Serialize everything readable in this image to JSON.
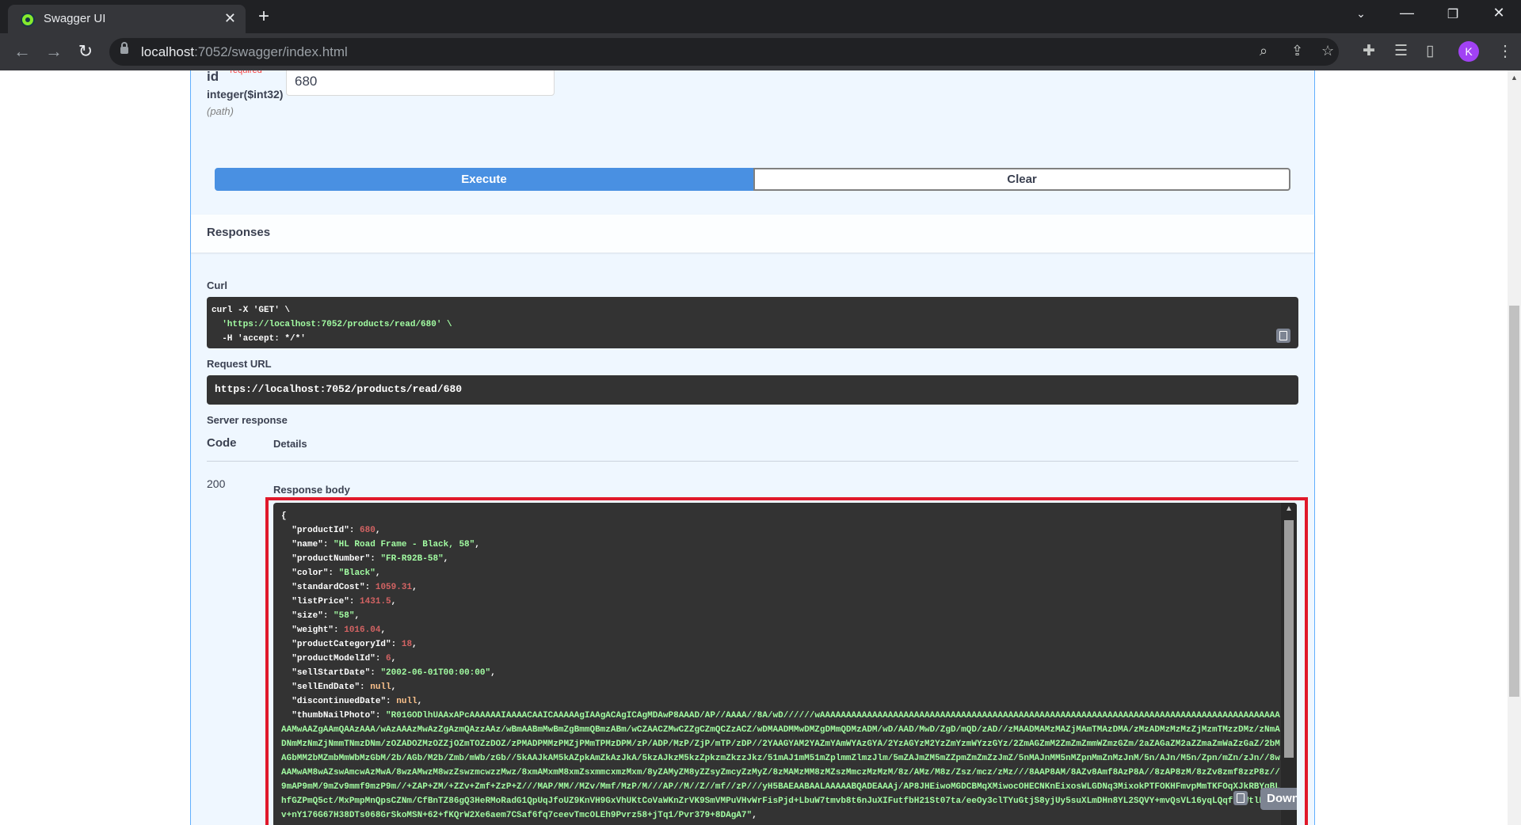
{
  "browser": {
    "tab_title": "Swagger UI",
    "url_host": "localhost",
    "url_path": ":7052/swagger/index.html",
    "profile_initial": "K"
  },
  "parameter": {
    "name": "id",
    "required_marker": "*",
    "required_label": "required",
    "type": "integer($int32)",
    "location": "(path)",
    "value": "680"
  },
  "actions": {
    "execute_label": "Execute",
    "clear_label": "Clear"
  },
  "responses": {
    "title": "Responses",
    "curl_label": "Curl",
    "curl_lines": [
      "curl -X 'GET' \\",
      "  'https://localhost:7052/products/read/680' \\",
      "  -H 'accept: */*'"
    ],
    "request_url_label": "Request URL",
    "request_url": "https://localhost:7052/products/read/680",
    "server_response_label": "Server response",
    "col_code": "Code",
    "col_details": "Details",
    "status_code": "200",
    "response_body_label": "Response body",
    "download_label": "Download"
  },
  "response_body": {
    "open_brace": "{",
    "fields": [
      {
        "key": "productId",
        "value": "680",
        "kind": "number"
      },
      {
        "key": "name",
        "value": "\"HL Road Frame - Black, 58\"",
        "kind": "string"
      },
      {
        "key": "productNumber",
        "value": "\"FR-R92B-58\"",
        "kind": "string"
      },
      {
        "key": "color",
        "value": "\"Black\"",
        "kind": "string"
      },
      {
        "key": "standardCost",
        "value": "1059.31",
        "kind": "number"
      },
      {
        "key": "listPrice",
        "value": "1431.5",
        "kind": "number"
      },
      {
        "key": "size",
        "value": "\"58\"",
        "kind": "string"
      },
      {
        "key": "weight",
        "value": "1016.04",
        "kind": "number"
      },
      {
        "key": "productCategoryId",
        "value": "18",
        "kind": "number"
      },
      {
        "key": "productModelId",
        "value": "6",
        "kind": "number"
      },
      {
        "key": "sellStartDate",
        "value": "\"2002-06-01T00:00:00\"",
        "kind": "string"
      },
      {
        "key": "sellEndDate",
        "value": "null",
        "kind": "null"
      },
      {
        "key": "discontinuedDate",
        "value": "null",
        "kind": "null"
      }
    ],
    "thumbnail_key": "thumbNailPhoto",
    "thumbnail_value": "\"R01GODlhUAAxAPcAAAAAAIAAAACAAICAAAAAgIAAgACAgICAgMDAwP8AAAD/AP//AAAA//8A/wD//////wAAAAAAAAAAAAAAAAAAAAAAAAAAAAAAAAAAAAAAAAAAAAAAAAAAAAAAAAAAAAAAAAAAAAAAAAAAAAAAAAAAAAAAAAAAMwAAZgAAmQAAzAAA/wAzAAAzMwAzZgAzmQAzzAAz/wBmAABmMwBmZgBmmQBmzABm/wCZAACZMwCZZgCZmQCZzACZ/wDMAADMMwDMZgDMmQDMzADM/wD/AAD/MwD/ZgD/mQD/zAD//zMAADMAMzMAZjMAmTMAzDMA/zMzADMzMzMzZjMzmTMzzDMz/zNmADNmMzNmZjNmmTNmzDNm/zOZADOZMzOZZjOZmTOZzDOZ/zPMADPMMzPMZjPMmTPMzDPM/zP/ADP/MzP/ZjP/mTP/zDP//2YAAGYAM2YAZmYAmWYAzGYA/2YzAGYzM2YzZmYzmWYzzGYz/2ZmAGZmM2ZmZmZmmWZmzGZm/2aZAGaZM2aZZmaZmWaZzGaZ/2bMAGbMM2bMZmbMmWbMzGbM/2b/AGb/M2b/Zmb/mWb/zGb//5kAAJkAM5kAZpkAmZkAzJkA/5kzAJkzM5kzZpkzmZkzzJkz/51mAJ1mM51mZplmmZlmzJlm/5mZAJmZM5mZZpmZmZmZzJmZ/5nMAJnMM5nMZpnMmZnMzJnM/5n/AJn/M5n/Zpn/mZn/zJn//8wAAMwAM8wAZswAmcwAzMwA/8wzAMwzM8wzZswzmcwzzMwz/8xmAMxmM8xmZsxmmcxmzMxm/8yZAMyZM8yZZsyZmcyZzMyZ/8zMAMzMM8zMZszMmczMzMzM/8z/AMz/M8z/Zsz/mcz/zMz///8AAP8AM/8AZv8Amf8AzP8A//8zAP8zM/8zZv8zmf8zzP8z//9mAP9mM/9mZv9mmf9mzP9m//+ZAP+ZM/+ZZv+Zmf+ZzP+Z///MAP/MM//MZv/Mmf/MzP/M///AP//M//Z//mf//zP///yH5BAEAABAALAAAAABQADEAAAj/AP8JHEiwoMGDCBMqXMiwocOHECNKnEixosWLGDNq3MixokPTFOKHFmvpMmTKFOqXJkRBYqBLhfGZPmQ5ct/MxPmpMnQpsCZNm/CfBnTZ86gQ3HeRMoRadG1QpUqJfoUZ9KnVH9GxVhUKtCoVaWKnZrVK9SmVMPuVHvWrFisPjd+LbuW7tmvb8t6nJuXIFutfbH21St07ta/eeOy3clTYuGtjS8yjUy5suXLmDHn8YL2SQVY+mvQsVL16yqLQqfuyWtlHZbTv+nY176G67H38DTs068GrSkoMSN+62+fKQrW2Xe6aem7CSaf6fq7ceevTmcOLEh9Pvrz58+jTq1/Pvr379+8DAgA7\""
  }
}
